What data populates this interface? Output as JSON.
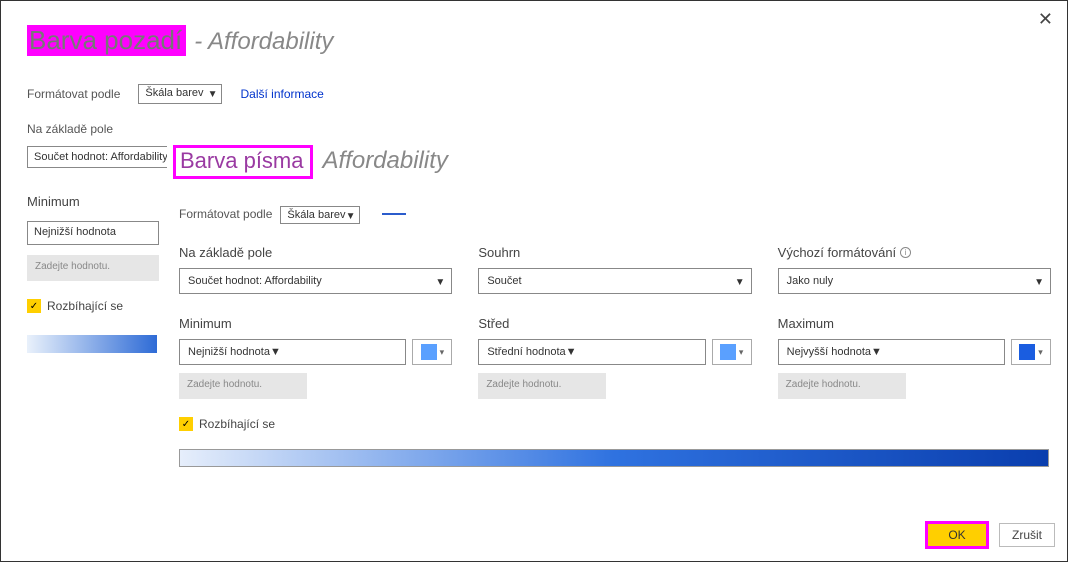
{
  "back": {
    "title": "Barva pozadí",
    "dash": "-",
    "subtitle": "Affordability",
    "format_by_label": "Formátovat podle",
    "format_by_value": "Škála barev",
    "more_info": "Další informace",
    "based_on_label": "Na základě pole",
    "based_on_value": "Součet hodnot: Affordability",
    "min_label": "Minimum",
    "min_select": "Nejnižší hodnota",
    "enter_value": "Zadejte hodnotu.",
    "diverging": "Rozbíhající se"
  },
  "front": {
    "title": "Barva písma",
    "subtitle": "Affordability",
    "format_by_label": "Formátovat podle",
    "format_by_value": "Škála barev",
    "based_on_label": "Na základě pole",
    "based_on_value": "Součet hodnot: Affordability",
    "summary_label": "Souhrn",
    "summary_value": "Součet",
    "default_label": "Výchozí formátování",
    "default_value": "Jako nuly",
    "min_label": "Minimum",
    "min_value": "Nejnižší hodnota",
    "mid_label": "Střed",
    "mid_value": "Střední hodnota",
    "max_label": "Maximum",
    "max_value": "Nejvyšší hodnota",
    "enter_value": "Zadejte hodnotu.",
    "diverging": "Rozbíhající se",
    "ok": "OK",
    "cancel": "Zrušit"
  }
}
